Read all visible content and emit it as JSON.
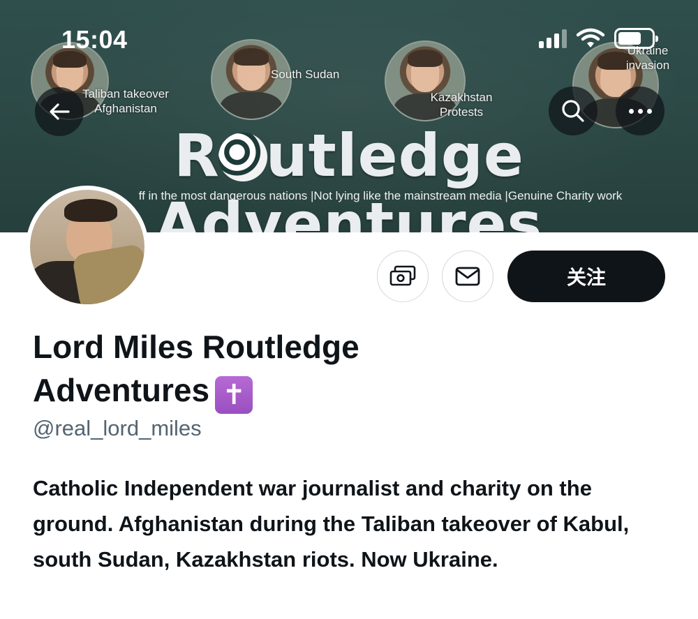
{
  "status_bar": {
    "time": "15:04",
    "signal_icon": "cellular-signal-icon",
    "wifi_icon": "wifi-icon",
    "battery_icon": "battery-icon"
  },
  "banner": {
    "title_prefix": "R",
    "title_suffix": "utledge Adventures",
    "globe_icon": "globe-icon",
    "tagline": "ff in the most dangerous nations |Not lying like the mainstream media |Genuine Charity work",
    "labels": [
      "Taliban takeover Afghanistan",
      "South Sudan",
      "Kazakhstan Protests",
      "Ukraine invasion"
    ]
  },
  "header_buttons": {
    "back_icon": "arrow-left-icon",
    "search_icon": "search-icon",
    "more_icon": "more-options-icon"
  },
  "actions": {
    "tip_icon": "money-tip-icon",
    "message_icon": "envelope-icon",
    "follow_label": "关注"
  },
  "profile": {
    "name": "Lord Miles Routledge Adventures",
    "badge_icon": "latin-cross-emoji",
    "badge_glyph": "✝",
    "handle": "@real_lord_miles",
    "bio": "Catholic Independent war journalist and charity on the ground. Afghanistan during the Taliban takeover of Kabul, south Sudan, Kazakhstan riots. Now Ukraine."
  }
}
